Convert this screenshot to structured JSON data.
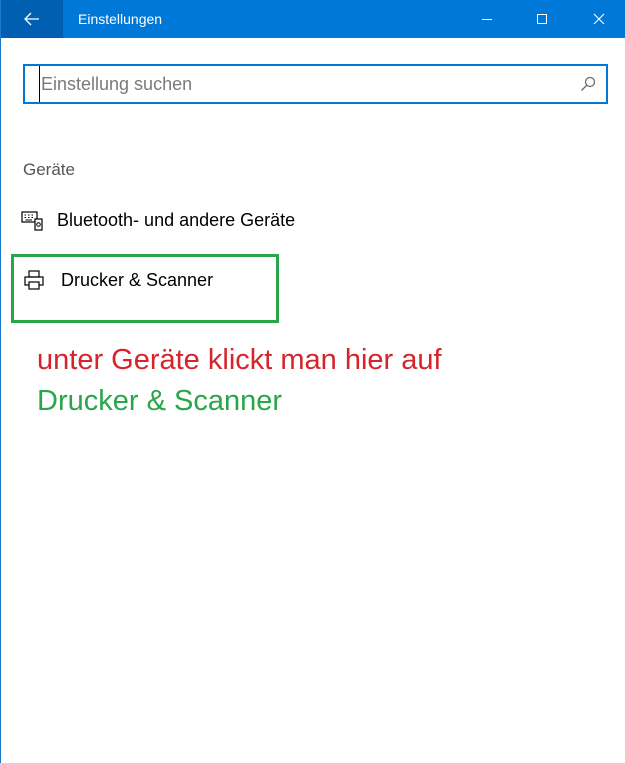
{
  "window": {
    "title": "Einstellungen",
    "accent_color": "#0078d7",
    "back_button_color": "#005fb0"
  },
  "titlebar": {
    "back_icon": "arrow-left-icon",
    "minimize_icon": "minimize-icon",
    "maximize_icon": "maximize-icon",
    "close_icon": "close-icon"
  },
  "search": {
    "placeholder": "Einstellung suchen",
    "value": "",
    "icon": "search-icon"
  },
  "section": {
    "header": "Geräte",
    "items": [
      {
        "label": "Bluetooth- und andere Geräte",
        "icon": "bluetooth-devices-icon"
      },
      {
        "label": "Drucker & Scanner",
        "icon": "printer-icon"
      }
    ]
  },
  "annotation": {
    "line1": "unter Geräte klickt man hier auf",
    "line2": "Drucker & Scanner",
    "line1_color": "#d7232b",
    "line2_color": "#2aa64a",
    "highlight_color": "#2aa64a"
  }
}
